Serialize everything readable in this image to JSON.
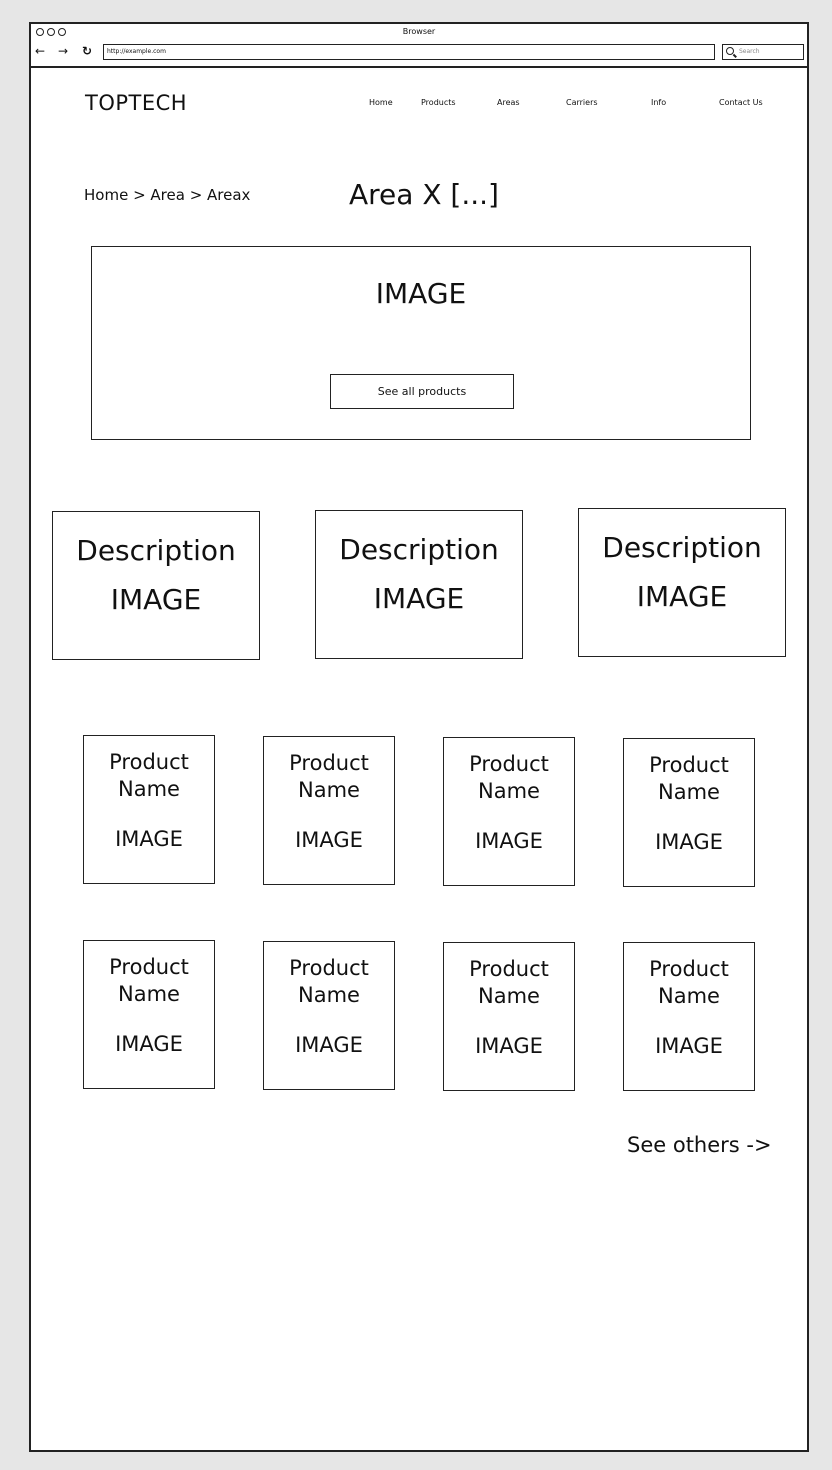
{
  "browser": {
    "title": "Browser",
    "back_label": "←",
    "forward_label": "→",
    "reload_label": "↻",
    "url": "http://example.com",
    "search_placeholder": "Search"
  },
  "site": {
    "logo": "TOPTECH",
    "nav": [
      "Home",
      "Products",
      "Areas",
      "Carriers",
      "Info",
      "Contact Us"
    ]
  },
  "breadcrumb": "Home > Area > Areax",
  "page_title": "Area X [...]",
  "hero": {
    "image_label": "IMAGE",
    "button_label": "See all products"
  },
  "descriptions": [
    {
      "title": "Description",
      "image": "IMAGE"
    },
    {
      "title": "Description",
      "image": "IMAGE"
    },
    {
      "title": "Description",
      "image": "IMAGE"
    }
  ],
  "products": [
    {
      "name": "Product Name",
      "image": "IMAGE"
    },
    {
      "name": "Product Name",
      "image": "IMAGE"
    },
    {
      "name": "Product Name",
      "image": "IMAGE"
    },
    {
      "name": "Product Name",
      "image": "IMAGE"
    },
    {
      "name": "Product Name",
      "image": "IMAGE"
    },
    {
      "name": "Product Name",
      "image": "IMAGE"
    },
    {
      "name": "Product Name",
      "image": "IMAGE"
    },
    {
      "name": "Product Name",
      "image": "IMAGE"
    }
  ],
  "see_others": "See others ->"
}
